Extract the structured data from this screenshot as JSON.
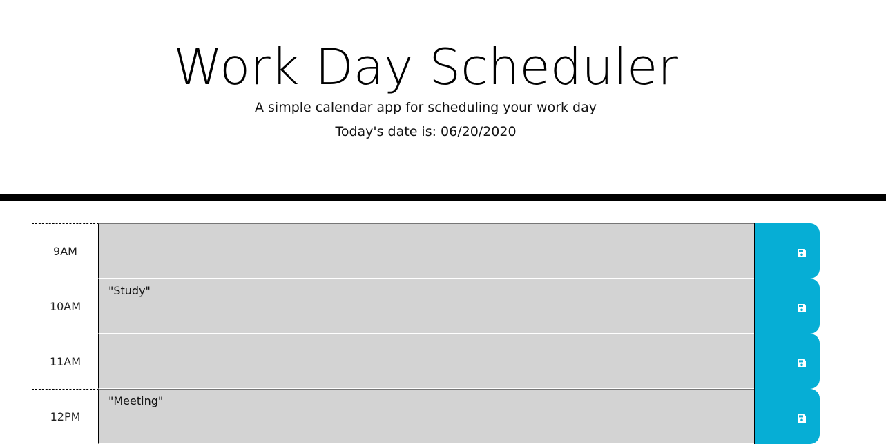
{
  "header": {
    "title": "Work Day Scheduler",
    "subtitle": "A simple calendar app for scheduling your work day",
    "date_line": "Today's date is: 06/20/2020"
  },
  "colors": {
    "past": "#d3d3d3",
    "save_button": "#06aed5",
    "divider": "#000000"
  },
  "rows": [
    {
      "hour": "9AM",
      "text": ""
    },
    {
      "hour": "10AM",
      "text": "\"Study\""
    },
    {
      "hour": "11AM",
      "text": ""
    },
    {
      "hour": "12PM",
      "text": "\"Meeting\""
    }
  ],
  "icons": {
    "save": "floppy-disk-icon"
  }
}
